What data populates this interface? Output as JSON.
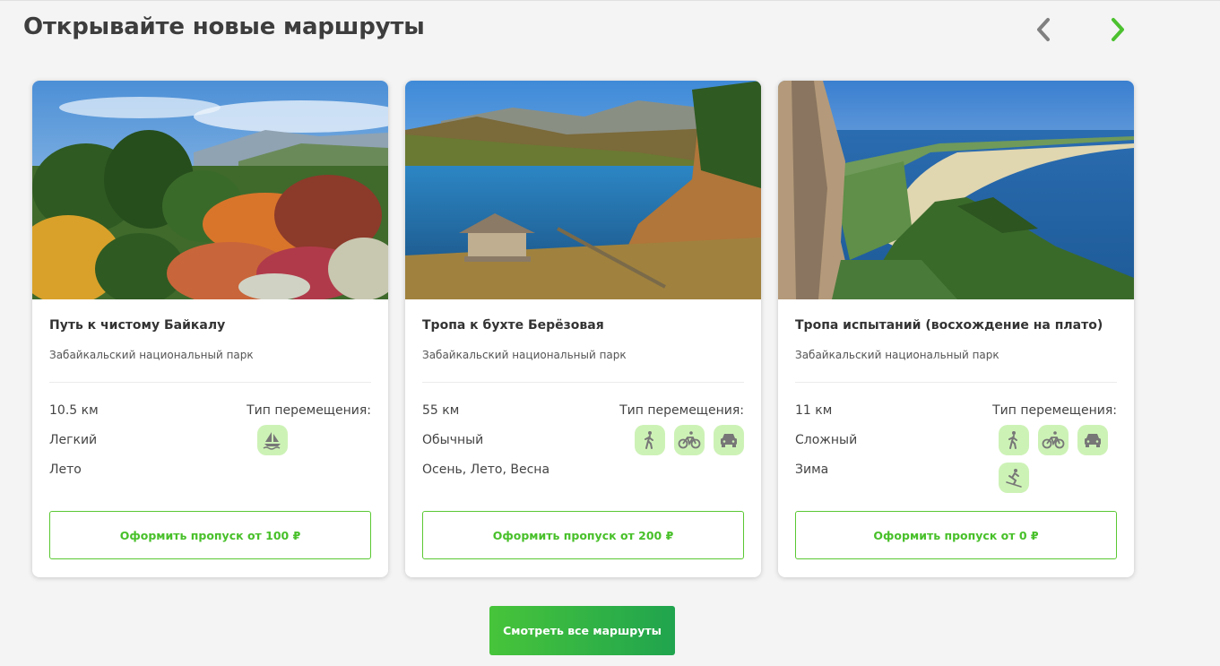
{
  "section": {
    "title": "Открывайте новые маршруты"
  },
  "carousel": {
    "prev_icon": "chevron-left-icon",
    "next_icon": "chevron-right-icon",
    "prev_color": "#808080",
    "next_color": "#4cc12f"
  },
  "cards": [
    {
      "title": "Путь к чистому Байкалу",
      "park": "Забайкальский национальный парк",
      "distance": "10.5 км",
      "difficulty": "Легкий",
      "season": "Лето",
      "move_label": "Тип перемещения:",
      "move_types": [
        "boat-icon"
      ],
      "button": "Оформить пропуск от 100 ₽"
    },
    {
      "title": "Тропа к бухте Берёзовая",
      "park": "Забайкальский национальный парк",
      "distance": "55 км",
      "difficulty": "Обычный",
      "season": "Осень, Лето, Весна",
      "move_label": "Тип перемещения:",
      "move_types": [
        "hiking-icon",
        "bicycle-icon",
        "car-icon"
      ],
      "button": "Оформить пропуск от 200 ₽"
    },
    {
      "title": "Тропа испытаний (восхождение на плато)",
      "park": "Забайкальский национальный парк",
      "distance": "11 км",
      "difficulty": "Сложный",
      "season": "Зима",
      "move_label": "Тип перемещения:",
      "move_types": [
        "hiking-icon",
        "bicycle-icon",
        "car-icon",
        "skiing-icon"
      ],
      "button": "Оформить пропуск от 0 ₽"
    }
  ],
  "footer": {
    "all_routes_button": "Смотреть все маршруты"
  },
  "colors": {
    "accent": "#4cc12f",
    "icon_bg": "#cdf2b6",
    "icon_fg": "#7a7a7a"
  }
}
